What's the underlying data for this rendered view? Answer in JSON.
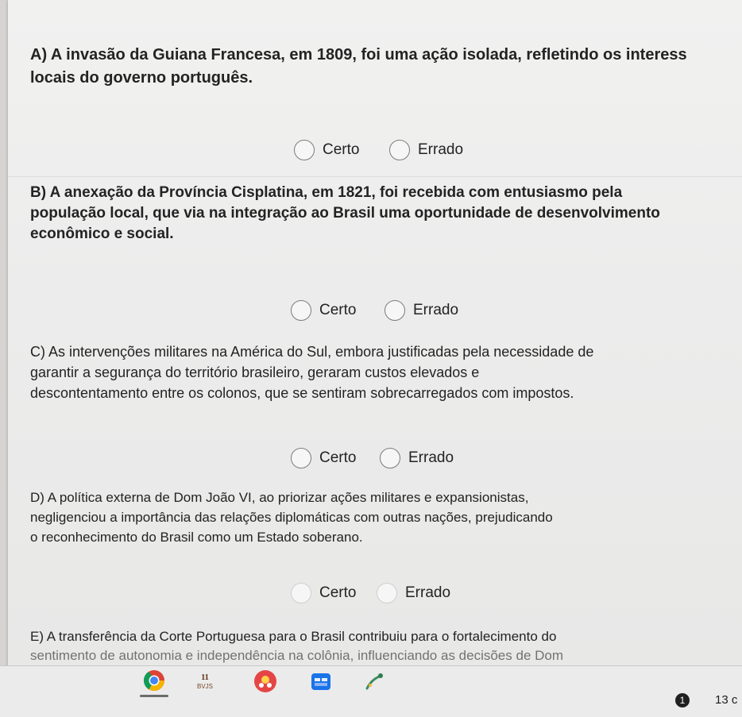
{
  "questions": [
    {
      "id": "A",
      "lines": [
        "A) A invasão da Guiana Francesa, em 1809, foi uma ação isolada, refletindo os interess",
        "locais do governo português."
      ],
      "options": [
        "Certo",
        "Errado"
      ]
    },
    {
      "id": "B",
      "lines": [
        "B) A anexação da Província Cisplatina, em 1821, foi recebida com entusiasmo pela",
        "população local, que via na integração ao Brasil uma oportunidade de desenvolvimento",
        "econômico e social."
      ],
      "options": [
        "Certo",
        "Errado"
      ]
    },
    {
      "id": "C",
      "lines": [
        "C) As intervenções militares na América do Sul, embora justificadas pela necessidade de",
        "garantir a segurança do território brasileiro, geraram custos elevados e",
        "descontentamento entre os colonos, que se sentiram sobrecarregados com impostos."
      ],
      "options": [
        "Certo",
        "Errado"
      ]
    },
    {
      "id": "D",
      "lines": [
        "D) A política externa de Dom João VI, ao priorizar ações militares e expansionistas,",
        "negligenciou a importância das relações diplomáticas com outras nações, prejudicando",
        "o reconhecimento do Brasil como um Estado soberano."
      ],
      "options": [
        "Certo",
        "Errado"
      ]
    },
    {
      "id": "E",
      "lines": [
        "E) A transferência da Corte Portuguesa para o Brasil contribuiu para o fortalecimento do",
        "sentimento de autonomia e independência na colônia, influenciando as decisões de Dom"
      ],
      "options": []
    }
  ],
  "taskbar": {
    "icons": [
      "chrome-icon",
      "news-icon",
      "game-icon",
      "calendar-icon",
      "tools-icon"
    ],
    "notification_count": "1",
    "clock_partial": "13 c"
  },
  "colors": {
    "page": "#ececec",
    "text": "#232323",
    "radio_border": "#7c7c7c"
  }
}
